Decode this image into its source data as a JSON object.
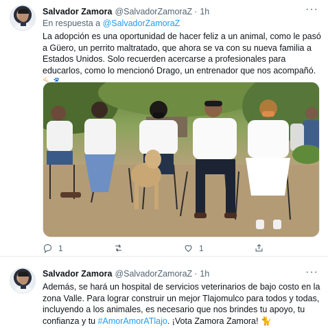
{
  "tweet1": {
    "author_name": "Salvador Zamora",
    "author_handle": "@SalvadorZamoraZ",
    "separator": "·",
    "time": "1h",
    "more_glyph": "···",
    "reply_prefix": "En respuesta a",
    "reply_to": "@SalvadorZamoraZ",
    "text": "La adopción es una oportunidad de hacer feliz a un animal, como le pasó a Güero, un perrito maltratado, que ahora se va con su nueva familia a Estados Unidos. Solo recuerden acercarse a profesionales para educarlos, como lo mencionó Drago, un entrenador que nos acompañó. 🦴🐾",
    "actions": {
      "reply_count": "1",
      "retweet_count": "",
      "like_count": "1",
      "share_count": ""
    }
  },
  "tweet2": {
    "author_name": "Salvador Zamora",
    "author_handle": "@SalvadorZamoraZ",
    "separator": "·",
    "time": "1h",
    "more_glyph": "···",
    "text_before": "Además, se hará un hospital de servicios veterinarios de bajo costo en la zona Valle. Para lograr construir un mejor Tlajomulco para todos y todas, incluyendo a los animales, es necesario que nos brindes tu apoyo, tu confianza y tu ",
    "hashtag": "#AmorAmorATlajo",
    "text_after": ". ¡Vota Zamora Zamora! 🐈"
  },
  "colors": {
    "accent": "#1d9bf0",
    "secondary_text": "#536471",
    "primary_text": "#0f1419",
    "divider": "#e6ecf0"
  },
  "icons": [
    "more-icon",
    "reply-icon",
    "retweet-icon",
    "like-icon",
    "share-icon"
  ]
}
